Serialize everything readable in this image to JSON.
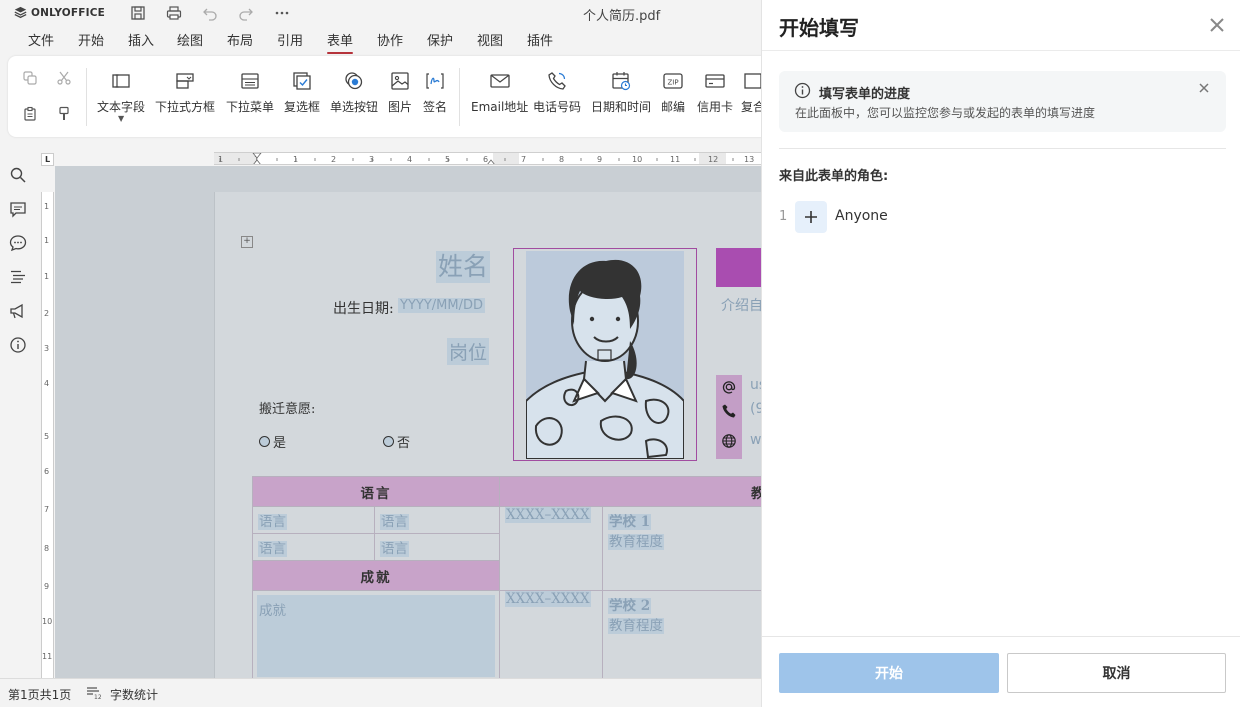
{
  "app": {
    "logo_text": "ONLYOFFICE",
    "doc_title": "个人简历.pdf"
  },
  "menu": [
    {
      "label": "文件"
    },
    {
      "label": "开始"
    },
    {
      "label": "插入"
    },
    {
      "label": "绘图"
    },
    {
      "label": "布局"
    },
    {
      "label": "引用"
    },
    {
      "label": "表单",
      "active": true
    },
    {
      "label": "协作"
    },
    {
      "label": "保护"
    },
    {
      "label": "视图"
    },
    {
      "label": "插件"
    }
  ],
  "toolbar": {
    "text_field": "文本字段",
    "combo_box": "下拉式方框",
    "dropdown": "下拉菜单",
    "checkbox": "复选框",
    "radio": "单选按钮",
    "image": "图片",
    "signature": "签名",
    "email": "Email地址",
    "phone": "电话号码",
    "datetime": "日期和时间",
    "zip": "邮编",
    "credit_card": "信用卡",
    "complex": "复合"
  },
  "document": {
    "name": "姓名",
    "birth_label": "出生日期:",
    "birth_value": "YYYY/MM/DD",
    "position": "岗位",
    "relocation_label": "搬迁意愿:",
    "radio_yes": "是",
    "radio_no": "否",
    "intro": "介绍自",
    "contacts": [
      {
        "icon": "at-icon",
        "text": "us"
      },
      {
        "icon": "phone-icon",
        "text": "(9"
      },
      {
        "icon": "globe-icon",
        "text": "w"
      }
    ],
    "table": {
      "lang_header": "语言",
      "edu_header": "教育",
      "lang_cells": [
        "语言",
        "语言",
        "语言",
        "语言"
      ],
      "achievement_header": "成就",
      "achievement_value": "成就",
      "edu_rows": [
        {
          "years": "XXXX–XXXX",
          "school": "学校 1",
          "degree": "教育程度"
        },
        {
          "years": "XXXX–XXXX",
          "school": "学校 2",
          "degree": "教育程度"
        }
      ]
    }
  },
  "status": {
    "page_count": "第1页共1页",
    "word_count": "字数统计"
  },
  "panel": {
    "title": "开始填写",
    "info_title": "填写表单的进度",
    "info_desc": "在此面板中，您可以监控您参与或发起的表单的填写进度",
    "roles_label": "来自此表单的角色:",
    "role_number": "1",
    "role_name": "Anyone",
    "start_button": "开始",
    "cancel_button": "取消"
  },
  "colors": {
    "accent_tab": "#b5333b",
    "start_button": "#9ec4ea",
    "field_fill": "#bcccd9",
    "table_header": "#c8a3c9",
    "purple_bar": "#a94db0"
  }
}
